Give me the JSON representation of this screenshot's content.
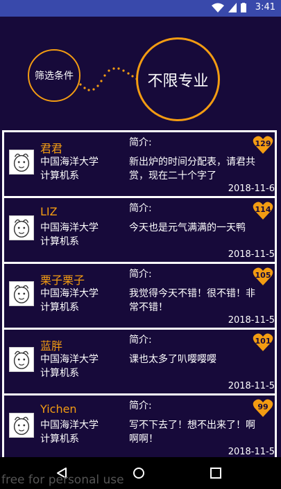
{
  "status": {
    "time": "3:41"
  },
  "filter": {
    "label": "筛选条件",
    "selected_major": "不限专业"
  },
  "intro_label": "简介:",
  "posts": [
    {
      "name": "君君",
      "school": "中国海洋大学",
      "major": "计算机系",
      "intro": "新出炉的时间分配表，请君共赏，现在二十个字了",
      "date": "2018-11-6",
      "likes": "129"
    },
    {
      "name": "LIZ",
      "school": "中国海洋大学",
      "major": "计算机系",
      "intro": "今天也是元气满满的一天鸭",
      "date": "2018-11-5",
      "likes": "114"
    },
    {
      "name": "栗子栗子",
      "school": "中国海洋大学",
      "major": "计算机系",
      "intro": "我觉得今天不错！很不错！非常不错！",
      "date": "2018-11-5",
      "likes": "105"
    },
    {
      "name": "蓝胖",
      "school": "中国海洋大学",
      "major": "计算机系",
      "intro": "课也太多了叭嘤嘤嘤",
      "date": "2018-11-5",
      "likes": "101"
    },
    {
      "name": "Yichen",
      "school": "中国海洋大学",
      "major": "计算机系",
      "intro": "写不下去了！想不出来了！啊啊啊！",
      "date": "2018-11-5",
      "likes": "99"
    }
  ],
  "watermark": "free for personal use",
  "colors": {
    "background": "#170a3a",
    "accent": "#f39c12",
    "status_bar": "#3949ab"
  }
}
